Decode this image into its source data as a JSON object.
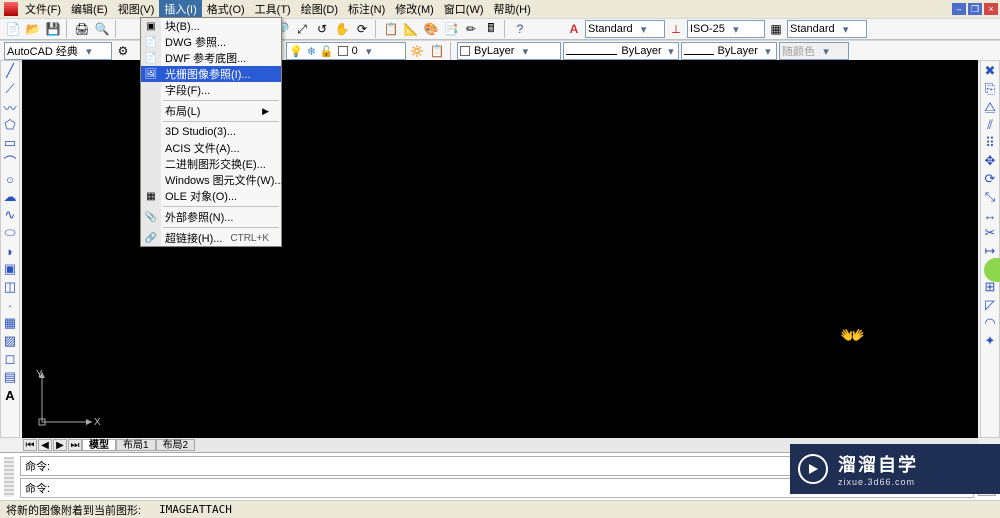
{
  "menubar": {
    "items": [
      "文件(F)",
      "编辑(E)",
      "视图(V)",
      "插入(I)",
      "格式(O)",
      "工具(T)",
      "绘图(D)",
      "标注(N)",
      "修改(M)",
      "窗口(W)",
      "帮助(H)"
    ],
    "open_index": 3
  },
  "toolbar1": {
    "workspace_combo": "AutoCAD 经典",
    "style_combo": "Standard",
    "dimstyle_combo": "ISO-25",
    "tablestyle_combo": "Standard"
  },
  "toolbar2": {
    "layer_combo": "0",
    "color_combo": "ByLayer",
    "linetype_combo": "ByLayer",
    "lineweight_combo": "ByLayer",
    "plotstyle_combo": "随颜色"
  },
  "dropdown": {
    "items": [
      {
        "icon": "block-icon",
        "label": "块(B)..."
      },
      {
        "icon": "dwg-icon",
        "label": "DWG 参照..."
      },
      {
        "icon": "dwf-icon",
        "label": "DWF 参考底图..."
      },
      {
        "icon": "raster-icon",
        "label": "光栅图像参照(I)...",
        "highlight": true
      },
      {
        "icon": "",
        "label": "字段(F)..."
      },
      {
        "sep": true
      },
      {
        "icon": "",
        "label": "布局(L)",
        "submenu": true
      },
      {
        "sep": true
      },
      {
        "icon": "",
        "label": "3D Studio(3)..."
      },
      {
        "icon": "",
        "label": "ACIS 文件(A)..."
      },
      {
        "icon": "",
        "label": "二进制图形交换(E)..."
      },
      {
        "icon": "",
        "label": "Windows 图元文件(W)..."
      },
      {
        "icon": "ole-icon",
        "label": "OLE 对象(O)..."
      },
      {
        "sep": true
      },
      {
        "icon": "xref-icon",
        "label": "外部参照(N)..."
      },
      {
        "sep": true
      },
      {
        "icon": "hyperlink-icon",
        "label": "超链接(H)...",
        "shortcut": "CTRL+K"
      }
    ]
  },
  "tabs": {
    "items": [
      "模型",
      "布局1",
      "布局2"
    ],
    "active": 0
  },
  "ucs": {
    "x_label": "X",
    "y_label": "Y"
  },
  "command": {
    "prompt": "命令:",
    "prompt2": "命令:"
  },
  "status": {
    "text": "将新的图像附着到当前图形:",
    "cmd": "IMAGEATTACH"
  },
  "watermark": {
    "line1": "溜溜自学",
    "line2": "zixue.3d66.com"
  }
}
